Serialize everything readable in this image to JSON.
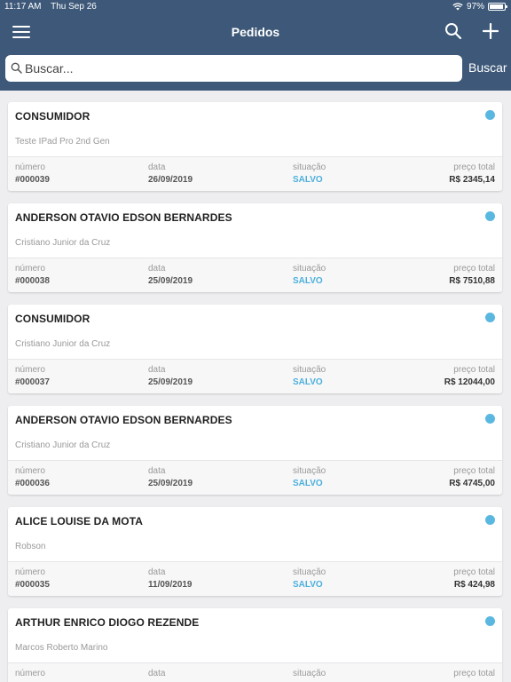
{
  "status": {
    "time": "11:17 AM",
    "date": "Thu Sep 26",
    "battery": "97%"
  },
  "nav": {
    "title": "Pedidos"
  },
  "search": {
    "placeholder": "Buscar...",
    "button": "Buscar"
  },
  "labels": {
    "numero": "número",
    "data": "data",
    "situacao": "situação",
    "preco": "preço total"
  },
  "orders": [
    {
      "client": "CONSUMIDOR",
      "vendor": "Teste IPad Pro 2nd Gen",
      "number": "#000039",
      "date": "26/09/2019",
      "status": "SALVO",
      "price": "R$ 2345,14"
    },
    {
      "client": "ANDERSON OTAVIO EDSON BERNARDES",
      "vendor": "Cristiano Junior da Cruz",
      "number": "#000038",
      "date": "25/09/2019",
      "status": "SALVO",
      "price": "R$ 7510,88"
    },
    {
      "client": "CONSUMIDOR",
      "vendor": "Cristiano Junior da Cruz",
      "number": "#000037",
      "date": "25/09/2019",
      "status": "SALVO",
      "price": "R$ 12044,00"
    },
    {
      "client": "ANDERSON OTAVIO EDSON BERNARDES",
      "vendor": "Cristiano Junior da Cruz",
      "number": "#000036",
      "date": "25/09/2019",
      "status": "SALVO",
      "price": "R$ 4745,00"
    },
    {
      "client": "ALICE LOUISE DA MOTA",
      "vendor": "Robson",
      "number": "#000035",
      "date": "11/09/2019",
      "status": "SALVO",
      "price": "R$ 424,98"
    },
    {
      "client": "ARTHUR ENRICO DIOGO REZENDE",
      "vendor": "Marcos Roberto Marino",
      "number": "",
      "date": "",
      "status": "",
      "price": ""
    }
  ],
  "colors": {
    "navbar": "#3d5878",
    "status_dot": "#5ab8e0",
    "status_text": "#4db0dc"
  },
  "icons": [
    "menu-icon",
    "search-icon",
    "plus-icon",
    "wifi-icon",
    "battery-icon",
    "magnifier-icon"
  ]
}
